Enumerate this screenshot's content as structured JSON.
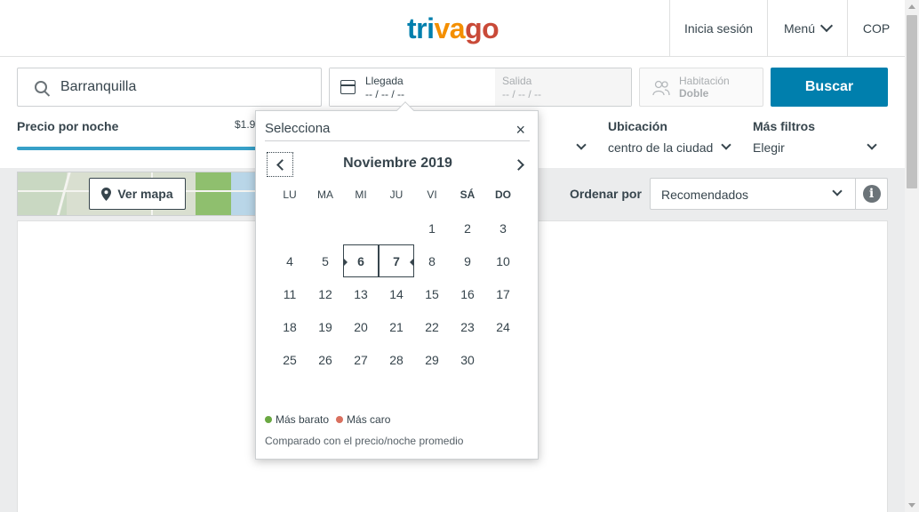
{
  "header": {
    "logo": {
      "part1": "tri",
      "part2": "va",
      "part3": "go"
    },
    "login": "Inicia sesión",
    "menu": "Menú",
    "currency": "COP"
  },
  "search": {
    "destination": "Barranquilla",
    "checkin_label": "Llegada",
    "checkin_value": "-- / -- / --",
    "checkout_label": "Salida",
    "checkout_value": "-- / -- / --",
    "room_label": "Habitación",
    "room_value": "Doble",
    "button": "Buscar"
  },
  "filters": {
    "price_title": "Precio por noche",
    "price_value": "$1.9",
    "location_title": "Ubicación",
    "location_value": "centro de la ciudad",
    "more_title": "Más filtros",
    "more_value": "Elegir"
  },
  "map": {
    "button": "Ver mapa"
  },
  "sort": {
    "label": "Ordenar por",
    "value": "Recomendados"
  },
  "calendar": {
    "header": "Selecciona",
    "close": "×",
    "month": "Noviembre 2019",
    "weekdays": [
      "LU",
      "MA",
      "MI",
      "JU",
      "VI",
      "SÁ",
      "DO"
    ],
    "bold_weekdays": [
      5,
      6
    ],
    "first_weekday_index": 4,
    "days_in_month": 30,
    "selected_start": 6,
    "selected_end": 7,
    "legend_cheap": "Más barato",
    "legend_expensive": "Más caro",
    "note": "Comparado con el precio/noche promedio",
    "colors": {
      "cheap": "#6aa842",
      "expensive": "#d9705f"
    }
  },
  "colors": {
    "brand_blue": "#007fad",
    "brand_orange": "#f48f00",
    "brand_red": "#c94a38"
  }
}
